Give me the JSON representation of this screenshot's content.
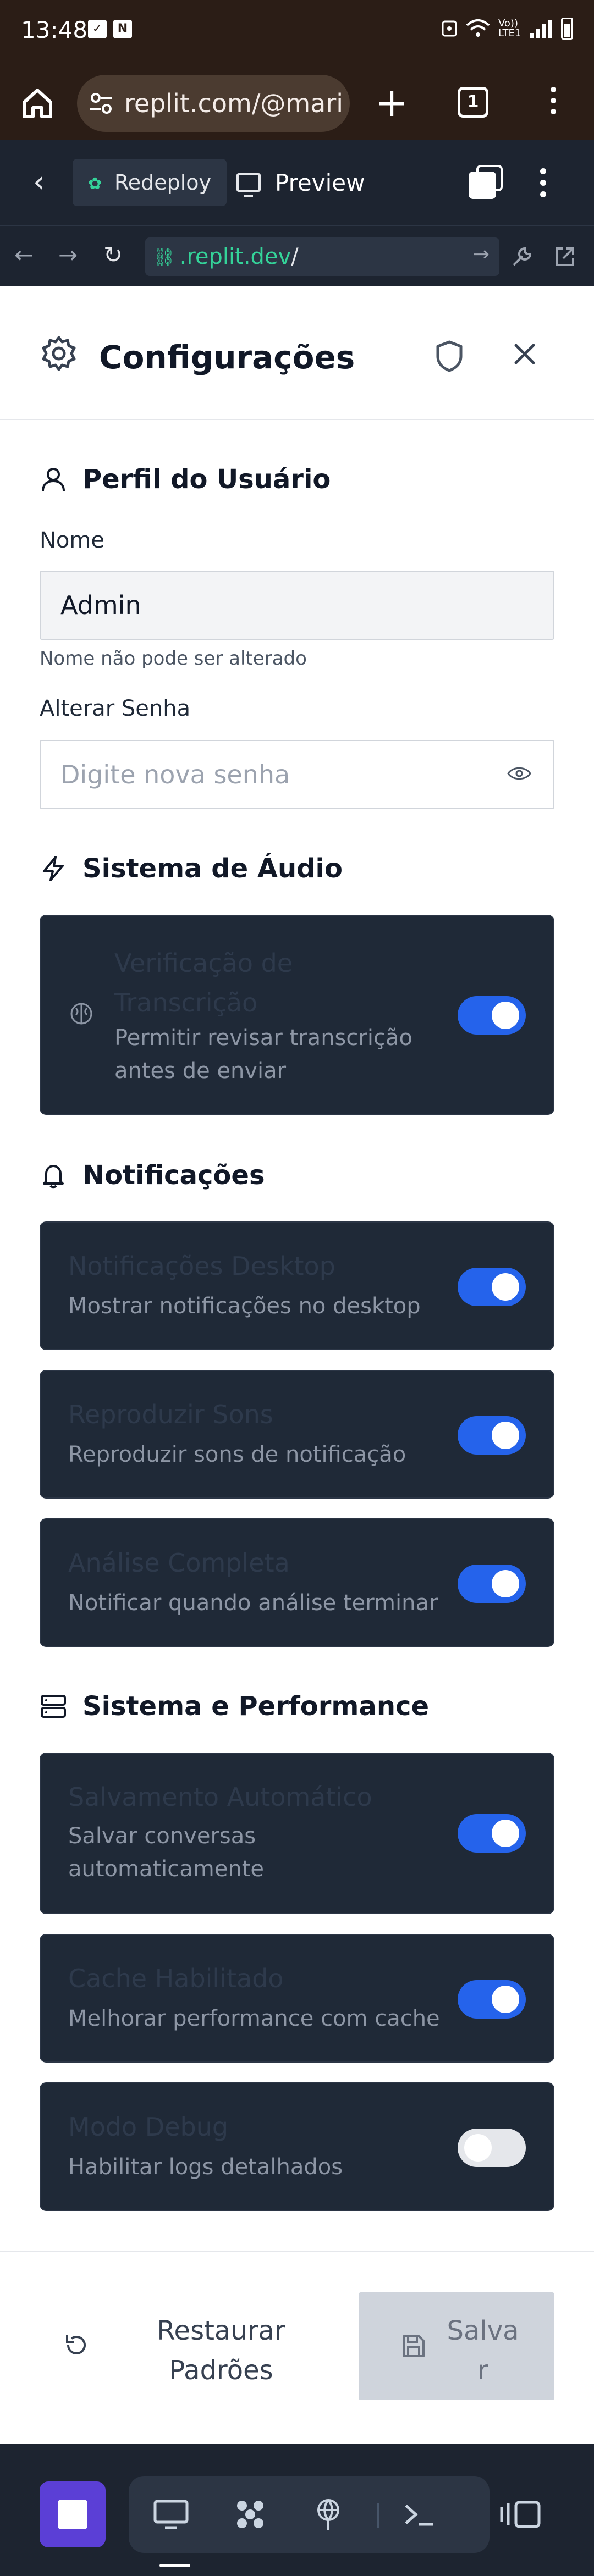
{
  "status_bar": {
    "time": "13:48",
    "network": "Vo)) LTE1"
  },
  "browser": {
    "url": "replit.com/@mari",
    "tab_count": "1"
  },
  "replit_toolbar": {
    "redeploy_label": "Redeploy",
    "preview_label": "Preview"
  },
  "replit_url": {
    "host": ".replit.dev",
    "path": "/"
  },
  "dialog": {
    "title": "Configurações"
  },
  "sections": {
    "profile": {
      "title": "Perfil do Usuário",
      "name_label": "Nome",
      "name_value": "Admin",
      "name_hint": "Nome não pode ser alterado",
      "password_label": "Alterar Senha",
      "password_placeholder": "Digite nova senha"
    },
    "audio": {
      "title": "Sistema de Áudio",
      "transcription": {
        "title": "Verificação de Transcrição",
        "title_line1": "Verificação de",
        "title_line2": "Transcrição",
        "desc_line1": "Permitir revisar transcrição",
        "desc_line2": "antes de enviar",
        "enabled": true
      }
    },
    "notifications": {
      "title": "Notificações",
      "items": [
        {
          "title": "Notificações Desktop",
          "desc": "Mostrar notificações no desktop",
          "enabled": true
        },
        {
          "title": "Reproduzir Sons",
          "desc": "Reproduzir sons de notificação",
          "enabled": true
        },
        {
          "title": "Análise Completa",
          "desc": "Notificar quando análise terminar",
          "enabled": true
        }
      ]
    },
    "system": {
      "title": "Sistema e Performance",
      "autosave": {
        "title": "Salvamento Automático",
        "desc_line1": "Salvar conversas",
        "desc_line2": "automaticamente",
        "enabled": true
      },
      "cache": {
        "title": "Cache Habilitado",
        "desc": "Melhorar performance com cache",
        "enabled": true
      },
      "debug": {
        "title": "Modo Debug",
        "desc": "Habilitar logs detalhados",
        "enabled": false
      }
    }
  },
  "footer": {
    "restore_line1": "Restaurar",
    "restore_line2": "Padrões",
    "save_line1": "Salva",
    "save_line2": "r"
  },
  "colors": {
    "accent": "#2563eb",
    "card_bg": "#1f2937",
    "replit_bar": "#1d2430",
    "browser_bar": "#2b1d16",
    "dock_home": "#5b3fd6"
  }
}
